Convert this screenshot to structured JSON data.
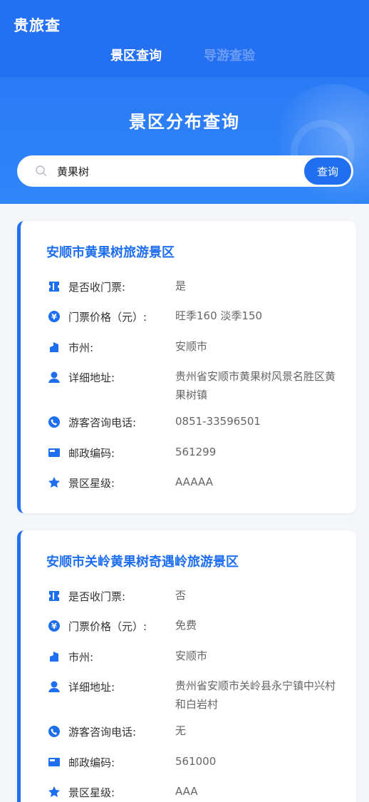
{
  "header": {
    "app_title": "贵旅查",
    "tabs": [
      {
        "label": "景区查询",
        "active": true
      },
      {
        "label": "导游查验",
        "active": false
      }
    ]
  },
  "hero": {
    "title": "景区分布查询"
  },
  "search": {
    "value": "黄果树",
    "button_label": "查询"
  },
  "colors": {
    "primary": "#2370f2",
    "title_blue": "#1e6ef0"
  },
  "field_labels": {
    "ticket_required": "是否收门票:",
    "ticket_price": "门票价格（元）:",
    "city": "市州:",
    "address": "详细地址:",
    "phone": "游客咨询电话:",
    "postal_code": "邮政编码:",
    "rating": "景区星级:"
  },
  "results": [
    {
      "name": "安顺市黄果树旅游景区",
      "ticket_required": "是",
      "ticket_price": "旺季160 淡季150",
      "city": "安顺市",
      "address": "贵州省安顺市黄果树风景名胜区黄果树镇",
      "phone": "0851-33596501",
      "postal_code": "561299",
      "rating": "AAAAA"
    },
    {
      "name": "安顺市关岭黄果树奇遇岭旅游景区",
      "ticket_required": "否",
      "ticket_price": "免费",
      "city": "安顺市",
      "address": "贵州省安顺市关岭县永宁镇中兴村和白岩村",
      "phone": "无",
      "postal_code": "561000",
      "rating": "AAA"
    }
  ]
}
